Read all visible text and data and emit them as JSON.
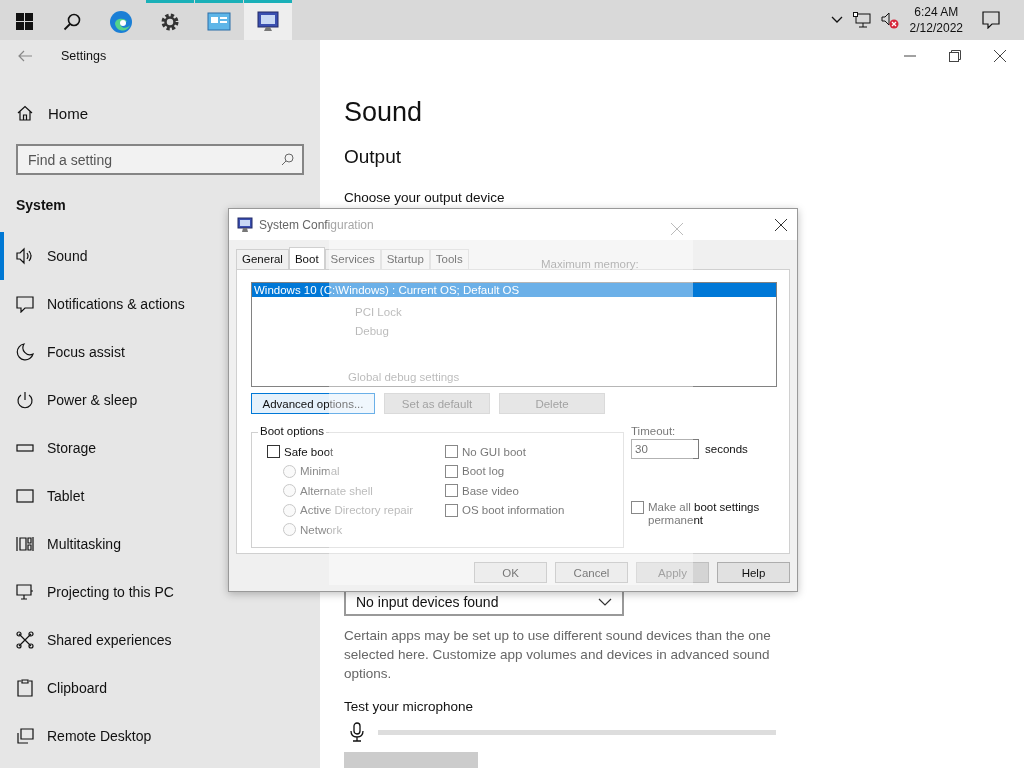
{
  "taskbar": {
    "apps": [
      {
        "kind": "edge",
        "running": false,
        "selected": false
      },
      {
        "kind": "settings",
        "running": true,
        "selected": false
      },
      {
        "kind": "control",
        "running": true,
        "selected": false
      },
      {
        "kind": "sysconfig",
        "running": true,
        "selected": true
      }
    ],
    "clock": {
      "time": "6:24 AM",
      "date": "2/12/2022"
    }
  },
  "settings": {
    "title": "Settings",
    "home": "Home",
    "search": {
      "placeholder": "Find a setting"
    },
    "section": "System",
    "nav": [
      {
        "label": "Sound",
        "selected": true
      },
      {
        "label": "Notifications & actions",
        "selected": false
      },
      {
        "label": "Focus assist",
        "selected": false
      },
      {
        "label": "Power & sleep",
        "selected": false
      },
      {
        "label": "Storage",
        "selected": false
      },
      {
        "label": "Tablet",
        "selected": false
      },
      {
        "label": "Multitasking",
        "selected": false
      },
      {
        "label": "Projecting to this PC",
        "selected": false
      },
      {
        "label": "Shared experiences",
        "selected": false
      },
      {
        "label": "Clipboard",
        "selected": false
      },
      {
        "label": "Remote Desktop",
        "selected": false
      }
    ]
  },
  "page": {
    "title": "Sound",
    "heading": "Output",
    "output_label": "Choose your output device",
    "input_device": "No input devices found",
    "note": "Certain apps may be set up to use different sound devices than the one selected here. Customize app volumes and devices in advanced sound options.",
    "test_label": "Test your microphone"
  },
  "dialog": {
    "title": "System Configuration",
    "tabs": [
      {
        "label": "General",
        "selected": false
      },
      {
        "label": "Boot",
        "selected": true
      },
      {
        "label": "Services",
        "selected": false
      },
      {
        "label": "Startup",
        "selected": false
      },
      {
        "label": "Tools",
        "selected": false
      }
    ],
    "boot_entries": [
      {
        "label": "Windows 10 (C:\\Windows) : Current OS; Default OS",
        "selected": true
      }
    ],
    "entry_buttons": [
      {
        "label": "Advanced options...",
        "disabled": false
      },
      {
        "label": "Set as default",
        "disabled": true
      },
      {
        "label": "Delete",
        "disabled": true
      }
    ],
    "boot_options": {
      "title": "Boot options",
      "safe_boot": {
        "label": "Safe boot",
        "checked": false
      },
      "modes": [
        {
          "label": "Minimal",
          "selected": false,
          "disabled": true
        },
        {
          "label": "Alternate shell",
          "selected": false,
          "disabled": true
        },
        {
          "label": "Active Directory repair",
          "selected": false,
          "disabled": true
        },
        {
          "label": "Network",
          "selected": false,
          "disabled": true
        }
      ],
      "flags": [
        {
          "label": "No GUI boot",
          "checked": false
        },
        {
          "label": "Boot log",
          "checked": false
        },
        {
          "label": "Base video",
          "checked": false
        },
        {
          "label": "OS boot information",
          "checked": false
        }
      ]
    },
    "timeout": {
      "label": "Timeout:",
      "value": "30",
      "unit": "seconds"
    },
    "permanent": {
      "label": "Make all boot settings permanent",
      "checked": false
    },
    "buttons": [
      {
        "label": "OK",
        "disabled": false
      },
      {
        "label": "Cancel",
        "disabled": false
      },
      {
        "label": "Apply",
        "disabled": true
      },
      {
        "label": "Help",
        "disabled": false
      }
    ]
  },
  "ghost_dialog": {
    "max_memory": "Maximum memory:",
    "checks": [
      "PCI Lock",
      "Debug"
    ],
    "group": "Global debug settings"
  }
}
